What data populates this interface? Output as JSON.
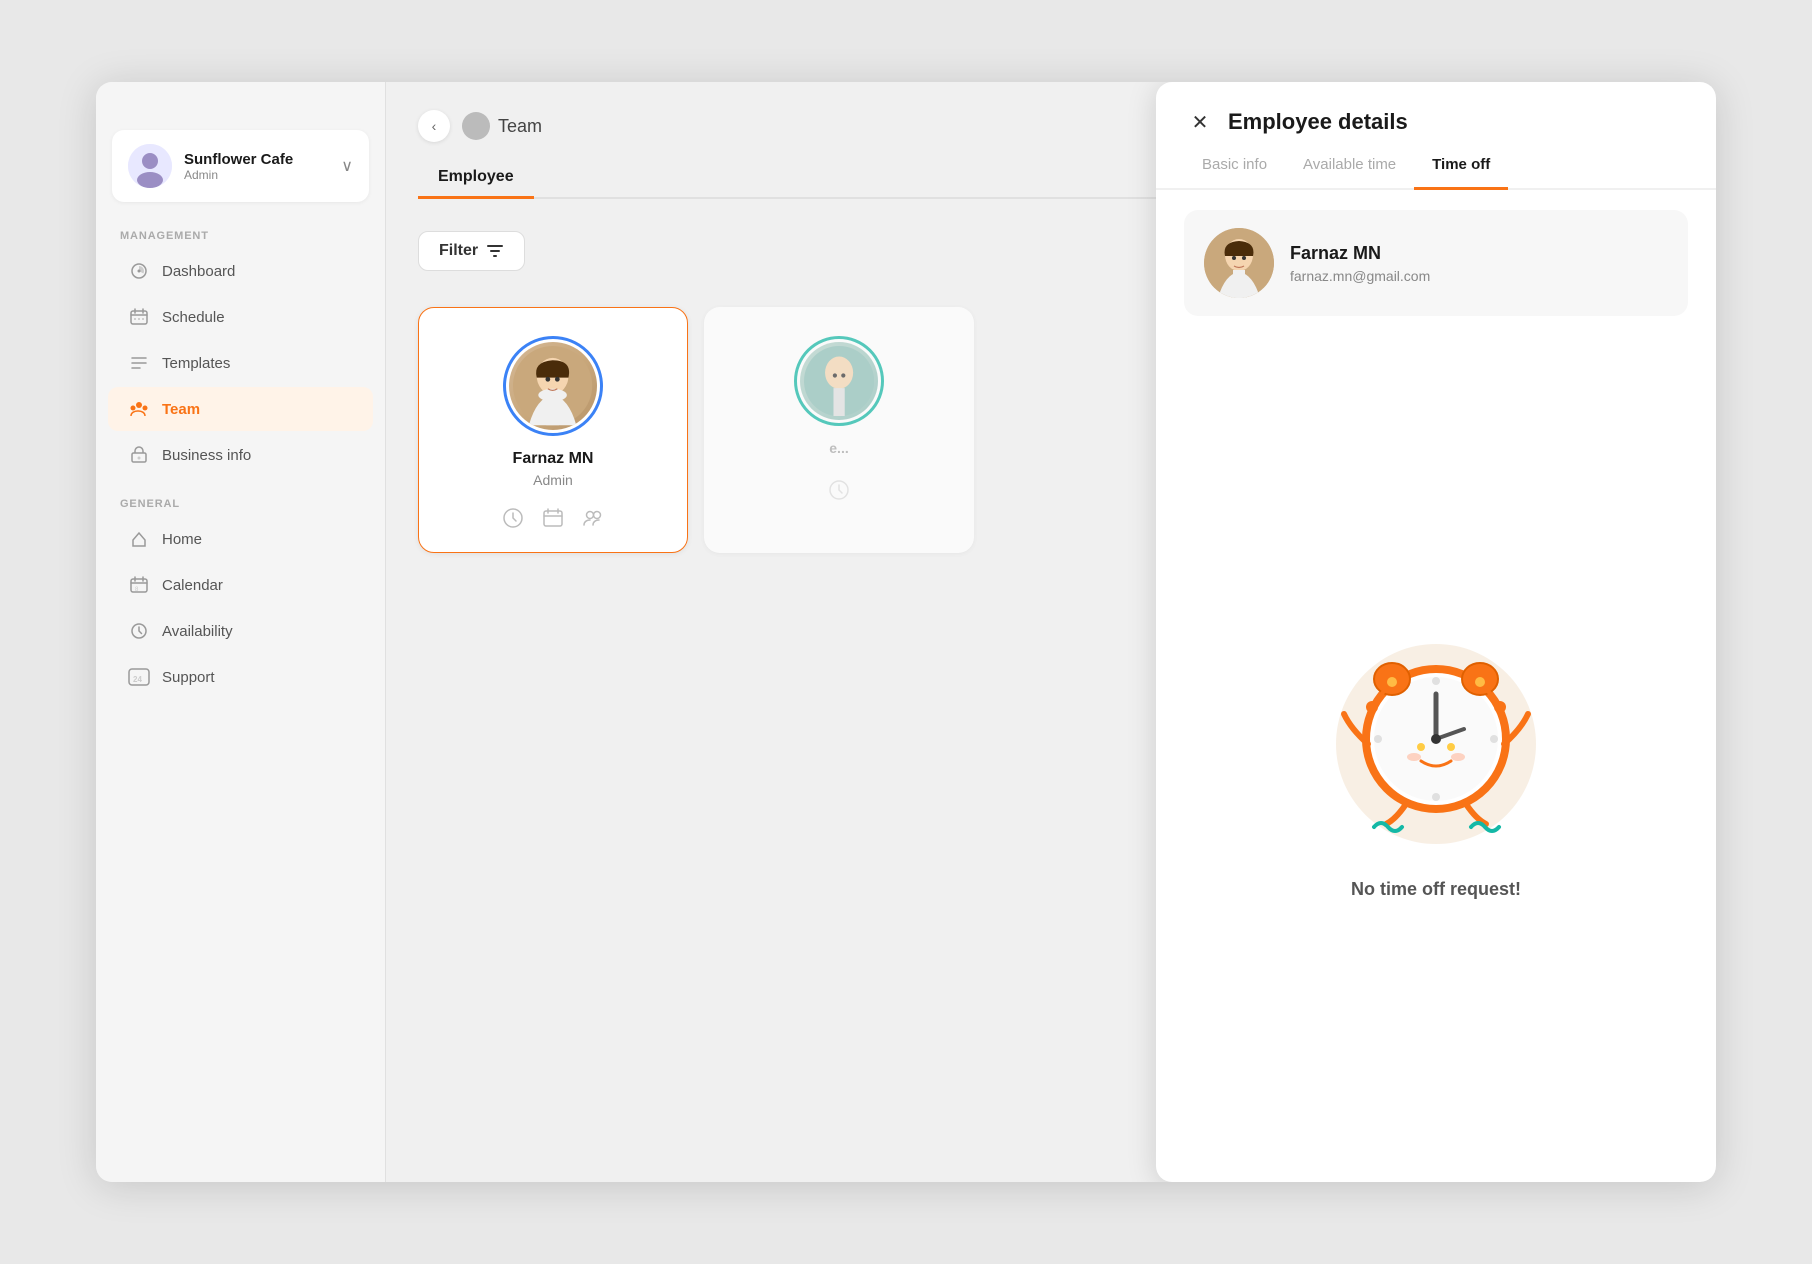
{
  "app": {
    "name": "Sunflower Cafe",
    "role": "Admin",
    "logo_emoji": "☕"
  },
  "sidebar": {
    "collapse_label": "‹",
    "management_label": "MANAGEMENT",
    "general_label": "GENERAL",
    "items_management": [
      {
        "id": "dashboard",
        "label": "Dashboard",
        "icon": "📊"
      },
      {
        "id": "schedule",
        "label": "Schedule",
        "icon": "📅"
      },
      {
        "id": "templates",
        "label": "Templates",
        "icon": "☰"
      },
      {
        "id": "team",
        "label": "Team",
        "icon": "✦",
        "active": true
      },
      {
        "id": "business-info",
        "label": "Business info",
        "icon": "🏢"
      }
    ],
    "items_general": [
      {
        "id": "home",
        "label": "Home",
        "icon": "📈"
      },
      {
        "id": "calendar",
        "label": "Calendar",
        "icon": "🗓"
      },
      {
        "id": "availability",
        "label": "Availability",
        "icon": "🕐"
      },
      {
        "id": "support",
        "label": "Support",
        "icon": "24"
      }
    ]
  },
  "breadcrumb": {
    "title": "Team"
  },
  "main": {
    "tabs": [
      {
        "id": "employee",
        "label": "Employee",
        "active": true
      }
    ],
    "filter_label": "Filter",
    "employees": [
      {
        "id": "farnaz",
        "name": "Farnaz MN",
        "role": "Admin",
        "selected": true
      },
      {
        "id": "emp2",
        "name": "e...",
        "role": "",
        "selected": false
      }
    ]
  },
  "detail": {
    "title": "Employee details",
    "close_icon": "✕",
    "tabs": [
      {
        "id": "basic-info",
        "label": "Basic info",
        "active": false
      },
      {
        "id": "available-time",
        "label": "Available time",
        "active": false
      },
      {
        "id": "time-off",
        "label": "Time off",
        "active": true
      }
    ],
    "employee": {
      "name": "Farnaz MN",
      "email": "farnaz.mn@gmail.com"
    },
    "no_request_label": "No time off request!"
  }
}
